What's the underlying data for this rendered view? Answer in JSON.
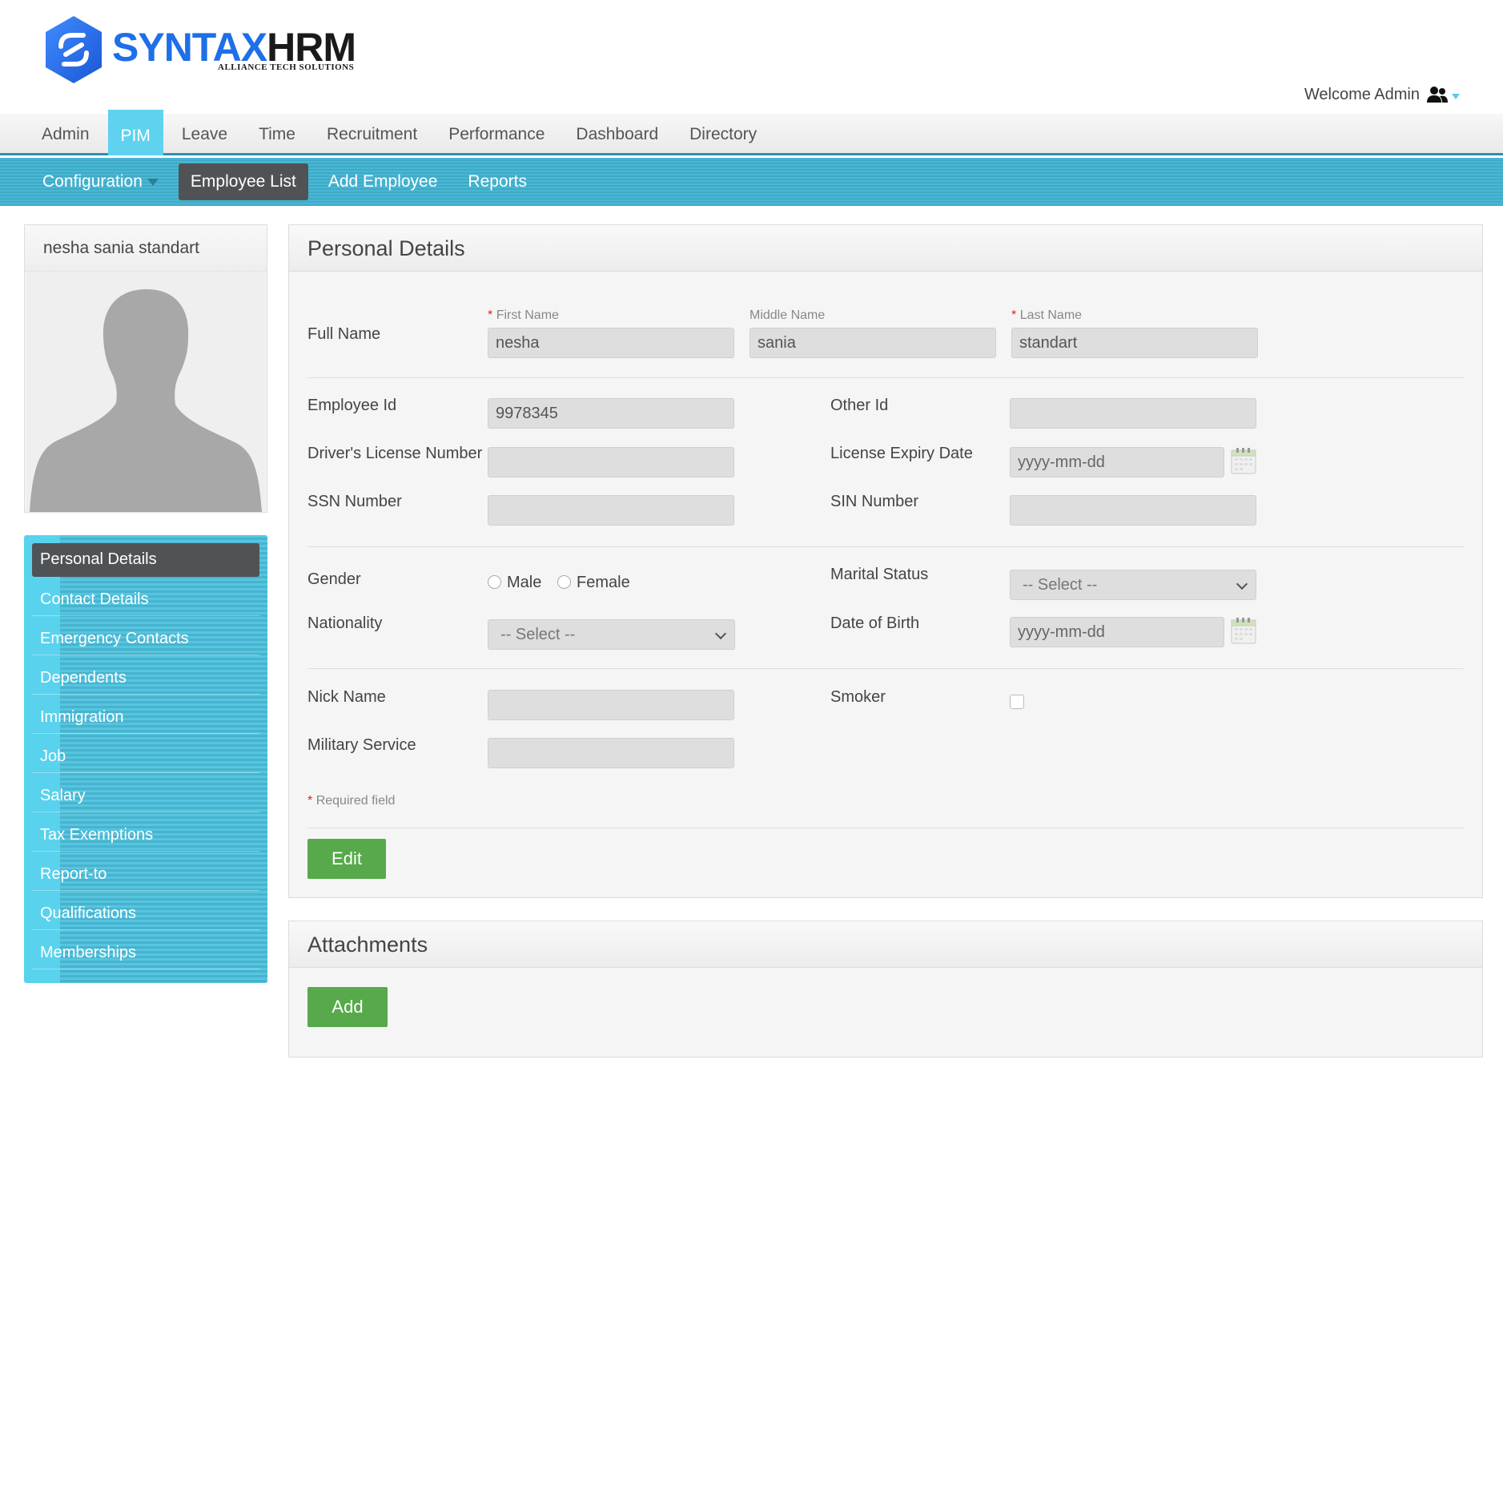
{
  "brand": {
    "word_part1": "SYNTAX",
    "word_part2": "HRM",
    "tagline": "ALLIANCE TECH SOLUTIONS"
  },
  "header": {
    "welcome": "Welcome Admin",
    "user_icon": "users-icon"
  },
  "top_nav": [
    {
      "label": "Admin",
      "active": false
    },
    {
      "label": "PIM",
      "active": true
    },
    {
      "label": "Leave",
      "active": false
    },
    {
      "label": "Time",
      "active": false
    },
    {
      "label": "Recruitment",
      "active": false
    },
    {
      "label": "Performance",
      "active": false
    },
    {
      "label": "Dashboard",
      "active": false
    },
    {
      "label": "Directory",
      "active": false
    }
  ],
  "sub_nav": [
    {
      "label": "Configuration",
      "active": false,
      "dropdown": true
    },
    {
      "label": "Employee List",
      "active": true
    },
    {
      "label": "Add Employee",
      "active": false
    },
    {
      "label": "Reports",
      "active": false
    }
  ],
  "profile": {
    "name": "nesha sania standart"
  },
  "side_menu": [
    {
      "label": "Personal Details",
      "active": true
    },
    {
      "label": "Contact Details"
    },
    {
      "label": "Emergency Contacts"
    },
    {
      "label": "Dependents"
    },
    {
      "label": "Immigration"
    },
    {
      "label": "Job"
    },
    {
      "label": "Salary"
    },
    {
      "label": "Tax Exemptions"
    },
    {
      "label": "Report-to"
    },
    {
      "label": "Qualifications"
    },
    {
      "label": "Memberships"
    }
  ],
  "personal_details": {
    "title": "Personal Details",
    "full_name_label": "Full Name",
    "first_name_label": "First Name",
    "middle_name_label": "Middle Name",
    "last_name_label": "Last Name",
    "required_marker": "*",
    "first_name": "nesha",
    "middle_name": "sania",
    "last_name": "standart",
    "employee_id_label": "Employee Id",
    "employee_id": "9978345",
    "other_id_label": "Other Id",
    "other_id": "",
    "drivers_license_label": "Driver's License Number",
    "drivers_license": "",
    "license_expiry_label": "License Expiry Date",
    "license_expiry": "yyyy-mm-dd",
    "ssn_label": "SSN Number",
    "ssn": "",
    "sin_label": "SIN Number",
    "sin": "",
    "gender_label": "Gender",
    "gender_options": [
      "Male",
      "Female"
    ],
    "marital_status_label": "Marital Status",
    "marital_status": "-- Select --",
    "nationality_label": "Nationality",
    "nationality": "-- Select --",
    "dob_label": "Date of Birth",
    "dob": "yyyy-mm-dd",
    "nick_name_label": "Nick Name",
    "nick_name": "",
    "smoker_label": "Smoker",
    "smoker_checked": false,
    "military_label": "Military Service",
    "military": "",
    "required_note": "Required field",
    "edit_button": "Edit"
  },
  "attachments": {
    "title": "Attachments",
    "add_button": "Add"
  },
  "colors": {
    "accent": "#5ed2ee",
    "subnav": "#45b4d0",
    "active_dark": "#505356",
    "button_green": "#57a94b",
    "logo_blue": "#1e6fe8"
  }
}
